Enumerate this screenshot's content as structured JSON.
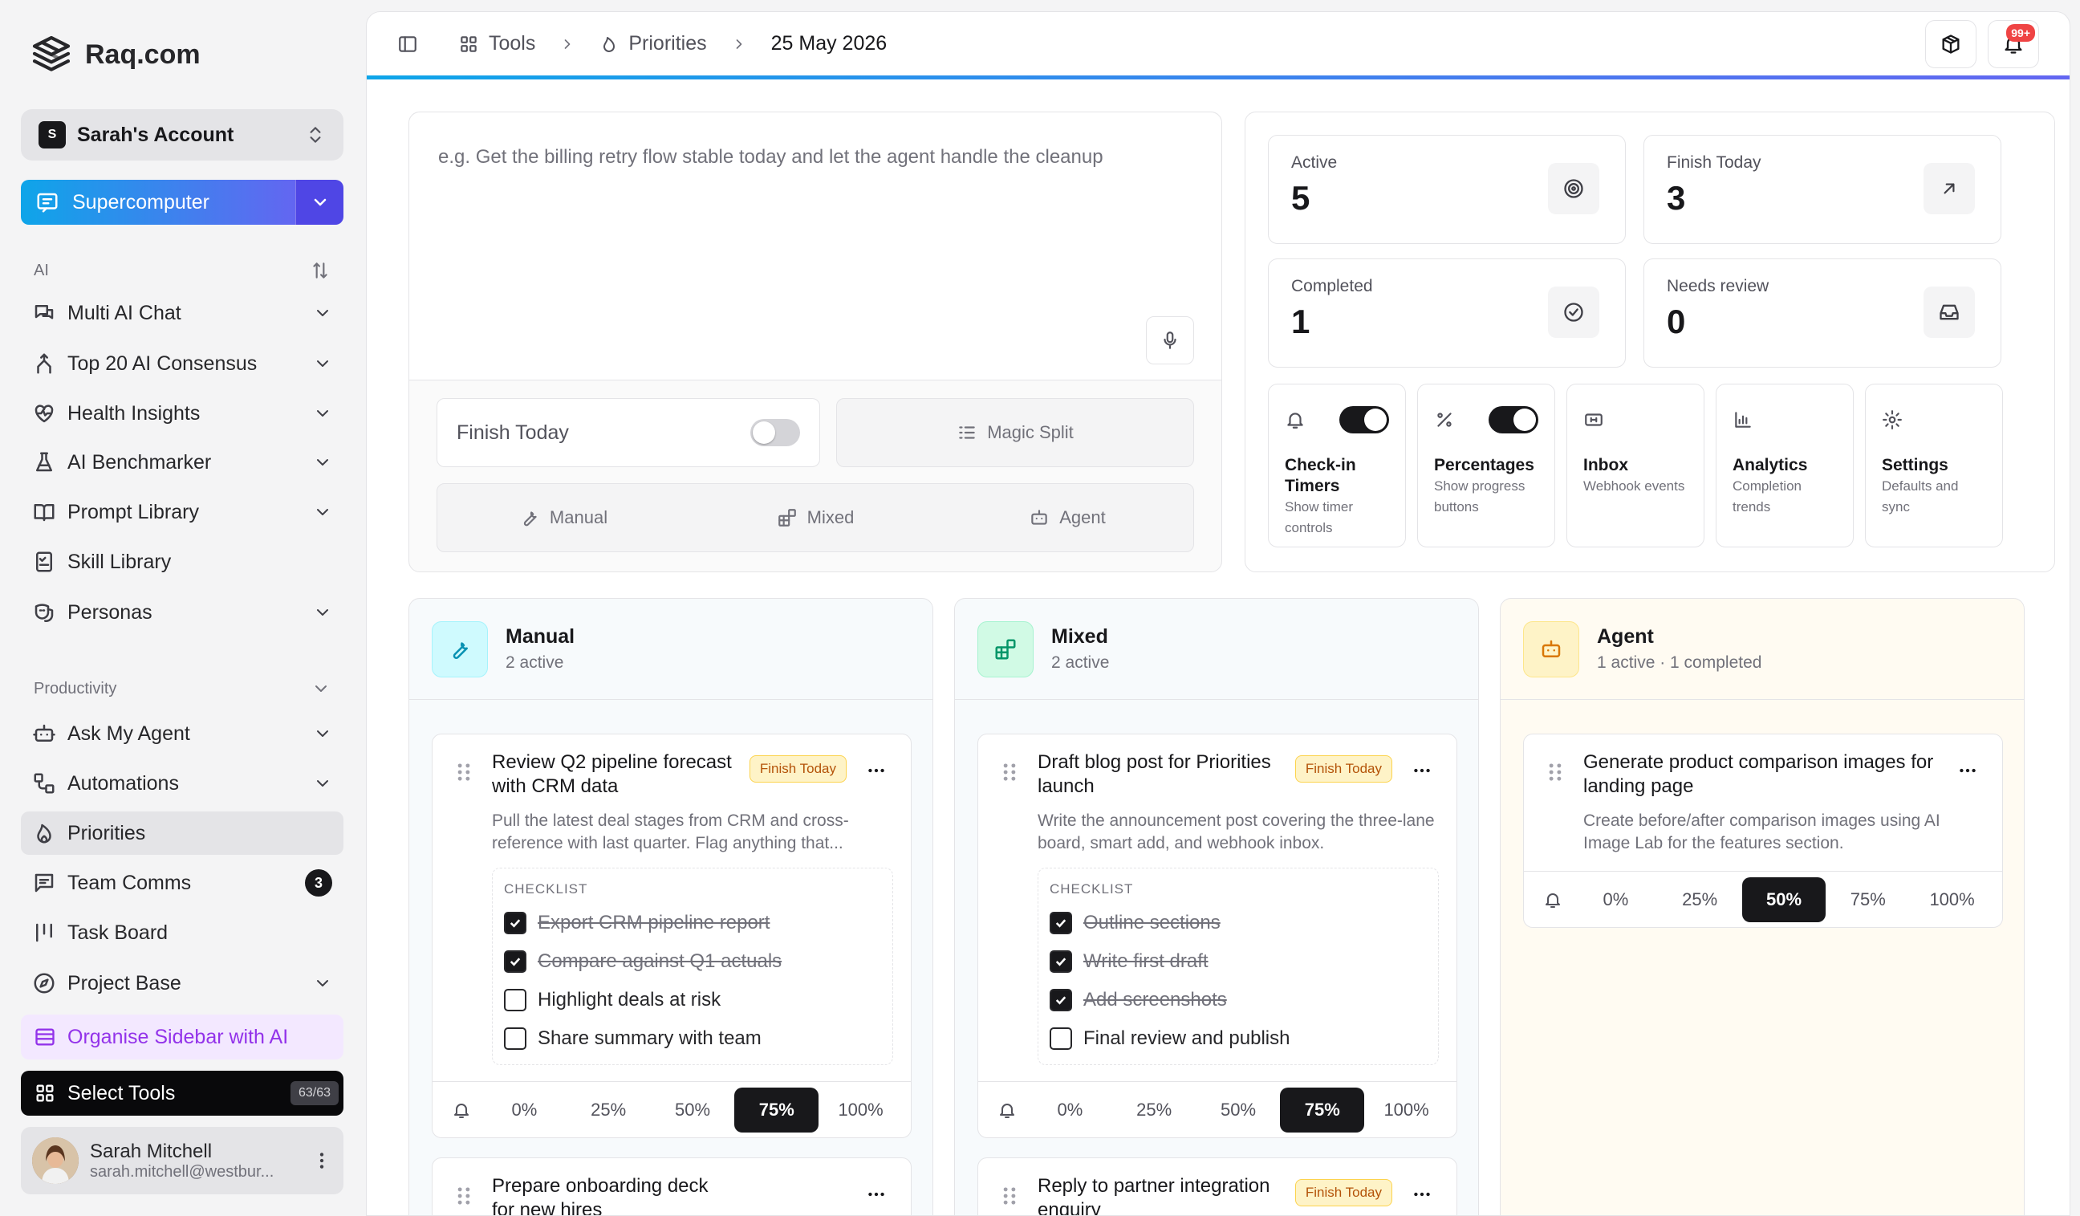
{
  "brand": {
    "name": "Raq.com"
  },
  "account": {
    "initial": "S",
    "name": "Sarah's Account"
  },
  "supercomputer": {
    "label": "Supercomputer"
  },
  "sidebar": {
    "ai_section": "AI",
    "ai_items": [
      {
        "label": "Multi AI Chat",
        "icon": "chat-icon",
        "chevron": true
      },
      {
        "label": "Top 20 AI Consensus",
        "icon": "merge-icon",
        "chevron": true
      },
      {
        "label": "Health Insights",
        "icon": "heart-icon",
        "chevron": true
      },
      {
        "label": "AI Benchmarker",
        "icon": "flask-icon",
        "chevron": true
      },
      {
        "label": "Prompt Library",
        "icon": "book-icon",
        "chevron": true
      },
      {
        "label": "Skill Library",
        "icon": "checklist-icon",
        "chevron": false
      },
      {
        "label": "Personas",
        "icon": "mask-icon",
        "chevron": true
      }
    ],
    "productivity_section": "Productivity",
    "productivity_items": [
      {
        "label": "Ask My Agent",
        "icon": "bot-icon",
        "chevron": true
      },
      {
        "label": "Automations",
        "icon": "workflow-icon",
        "chevron": true
      },
      {
        "label": "Priorities",
        "icon": "flame-icon",
        "active": true
      },
      {
        "label": "Team Comms",
        "icon": "message-icon",
        "badge": "3"
      },
      {
        "label": "Task Board",
        "icon": "board-icon"
      },
      {
        "label": "Project Base",
        "icon": "compass-icon",
        "chevron": true
      }
    ],
    "organise": "Organise Sidebar with AI",
    "select_tools": "Select Tools",
    "tools_count": "63/63",
    "user": {
      "name": "Sarah Mitchell",
      "email": "sarah.mitchell@westbur..."
    }
  },
  "breadcrumb": {
    "tools": "Tools",
    "priorities": "Priorities",
    "date": "25 May 2026"
  },
  "notifications": {
    "count": "99+"
  },
  "composer": {
    "placeholder": "e.g. Get the billing retry flow stable today and let the agent handle the cleanup",
    "finish_today": "Finish Today",
    "magic_split": "Magic Split",
    "modes": [
      "Manual",
      "Mixed",
      "Agent"
    ]
  },
  "stats": [
    {
      "label": "Active",
      "value": "5",
      "icon": "target-icon"
    },
    {
      "label": "Finish Today",
      "value": "3",
      "icon": "arrow-up-right-icon"
    },
    {
      "label": "Completed",
      "value": "1",
      "icon": "check-circle-icon"
    },
    {
      "label": "Needs review",
      "value": "0",
      "icon": "inbox-icon"
    }
  ],
  "features": [
    {
      "title": "Check-in Timers",
      "desc": "Show timer controls",
      "icon": "bell-icon",
      "toggle": true
    },
    {
      "title": "Percentages",
      "desc": "Show progress buttons",
      "icon": "percent-icon",
      "toggle": true
    },
    {
      "title": "Inbox",
      "desc": "Webhook events",
      "icon": "webhook-icon"
    },
    {
      "title": "Analytics",
      "desc": "Completion trends",
      "icon": "chart-icon"
    },
    {
      "title": "Settings",
      "desc": "Defaults and sync",
      "icon": "gear-icon"
    }
  ],
  "lanes": [
    {
      "title": "Manual",
      "subtitle": "2 active",
      "color": "#0891b2",
      "cards": [
        {
          "title": "Review Q2 pipeline forecast with CRM data",
          "badge": "Finish Today",
          "desc": "Pull the latest deal stages from CRM and cross-reference with last quarter. Flag anything that...",
          "checklist_label": "CHECKLIST",
          "checklist": [
            {
              "text": "Export CRM pipeline report",
              "done": true
            },
            {
              "text": "Compare against Q1 actuals",
              "done": true
            },
            {
              "text": "Highlight deals at risk",
              "done": false
            },
            {
              "text": "Share summary with team",
              "done": false
            }
          ],
          "progress": 75
        },
        {
          "title": "Prepare onboarding deck for new hires"
        }
      ]
    },
    {
      "title": "Mixed",
      "subtitle": "2 active",
      "color": "#059669",
      "cards": [
        {
          "title": "Draft blog post for Priorities launch",
          "badge": "Finish Today",
          "desc": "Write the announcement post covering the three-lane board, smart add, and webhook inbox.",
          "checklist_label": "CHECKLIST",
          "checklist": [
            {
              "text": "Outline sections",
              "done": true
            },
            {
              "text": "Write first draft",
              "done": true
            },
            {
              "text": "Add screenshots",
              "done": true
            },
            {
              "text": "Final review and publish",
              "done": false
            }
          ],
          "progress": 75
        },
        {
          "title": "Reply to partner integration enquiry",
          "badge": "Finish Today"
        }
      ]
    },
    {
      "title": "Agent",
      "subtitle": "1 active · 1 completed",
      "color": "#d97706",
      "cards": [
        {
          "title": "Generate product comparison images for landing page",
          "desc": "Create before/after comparison images using AI Image Lab for the features section.",
          "progress": 50
        }
      ]
    }
  ],
  "progress_options": [
    "0%",
    "25%",
    "50%",
    "75%",
    "100%"
  ]
}
